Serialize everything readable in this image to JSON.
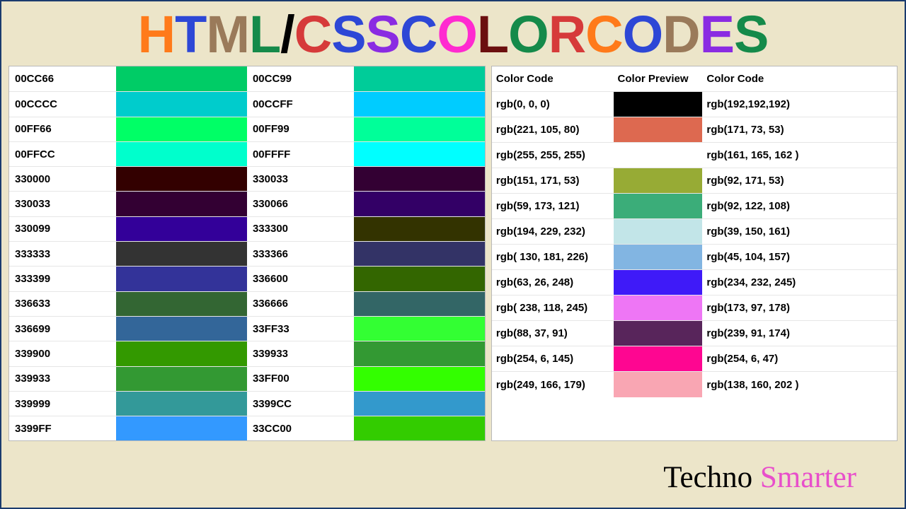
{
  "title": [
    {
      "t": "H",
      "c": "#ff7a1a"
    },
    {
      "t": "T",
      "c": "#2d47d6"
    },
    {
      "t": "M",
      "c": "#9a7a5a"
    },
    {
      "t": "L",
      "c": "#158a4a"
    },
    {
      "t": "/",
      "c": "#000"
    },
    {
      "t": "C",
      "c": "#d63a3a"
    },
    {
      "t": "S",
      "c": "#2d47d6"
    },
    {
      "t": "S",
      "c": "#8a2be2"
    },
    {
      "t": " ",
      "c": "#000"
    },
    {
      "t": "C",
      "c": "#2d47d6"
    },
    {
      "t": "O",
      "c": "#ff2ad0"
    },
    {
      "t": "L",
      "c": "#6b0f0f"
    },
    {
      "t": "O",
      "c": "#158a4a"
    },
    {
      "t": "R",
      "c": "#d63a3a"
    },
    {
      "t": " ",
      "c": "#000"
    },
    {
      "t": "C",
      "c": "#ff7a1a"
    },
    {
      "t": "O",
      "c": "#2d47d6"
    },
    {
      "t": "D",
      "c": "#9a7a5a"
    },
    {
      "t": "E",
      "c": "#8a2be2"
    },
    {
      "t": "S",
      "c": "#158a4a"
    }
  ],
  "hex_rows": [
    {
      "a": "00CC66",
      "b": "00CC99"
    },
    {
      "a": "00CCCC",
      "b": "00CCFF"
    },
    {
      "a": "00FF66",
      "b": "00FF99"
    },
    {
      "a": "00FFCC",
      "b": "00FFFF"
    },
    {
      "a": "330000",
      "b": "330033"
    },
    {
      "a": "330033",
      "b": "330066"
    },
    {
      "a": "330099",
      "b": "333300"
    },
    {
      "a": "333333",
      "b": "333366"
    },
    {
      "a": "333399",
      "b": "336600"
    },
    {
      "a": "336633",
      "b": "336666"
    },
    {
      "a": "336699",
      "b": "33FF33"
    },
    {
      "a": "339900",
      "b": "339933"
    },
    {
      "a": "339933",
      "b": "33FF00"
    },
    {
      "a": "339999",
      "b": "3399CC"
    },
    {
      "a": "3399FF",
      "b": "33CC00"
    }
  ],
  "rgb_headers": {
    "c1": "Color Code",
    "c2": "Color Preview",
    "c3": "Color Code"
  },
  "rgb_rows": [
    {
      "a": "rgb(0, 0, 0)",
      "ac": "rgb(0,0,0)",
      "b": "rgb(192,192,192)"
    },
    {
      "a": "rgb(221, 105, 80)",
      "ac": "rgb(221,105,80)",
      "b": "rgb(171, 73, 53)"
    },
    {
      "a": "rgb(255, 255, 255)",
      "ac": "rgb(255,255,255)",
      "b": "rgb(161, 165, 162 )"
    },
    {
      "a": "rgb(151, 171, 53)",
      "ac": "rgb(151,171,53)",
      "b": "rgb(92, 171, 53)"
    },
    {
      "a": "rgb(59, 173, 121)",
      "ac": "rgb(59,173,121)",
      "b": "rgb(92, 122, 108)"
    },
    {
      "a": "rgb(194, 229, 232)",
      "ac": "rgb(194,229,232)",
      "b": "rgb(39, 150, 161)"
    },
    {
      "a": "rgb( 130, 181, 226)",
      "ac": "rgb(130,181,226)",
      "b": "rgb(45, 104, 157)"
    },
    {
      "a": "rgb(63, 26, 248)",
      "ac": "rgb(63,26,248)",
      "b": "rgb(234, 232, 245)"
    },
    {
      "a": "rgb( 238, 118, 245)",
      "ac": "rgb(238,118,245)",
      "b": "rgb(173, 97, 178)"
    },
    {
      "a": "rgb(88, 37, 91)",
      "ac": "rgb(88,37,91)",
      "b": "rgb(239, 91, 174)"
    },
    {
      "a": "rgb(254, 6, 145)",
      "ac": "rgb(254,6,145)",
      "b": "rgb(254, 6, 47)"
    },
    {
      "a": "rgb(249, 166, 179)",
      "ac": "rgb(249,166,179)",
      "b": "rgb(138, 160, 202 )"
    }
  ],
  "footer": {
    "a": "Techno ",
    "b": "Smarter"
  }
}
